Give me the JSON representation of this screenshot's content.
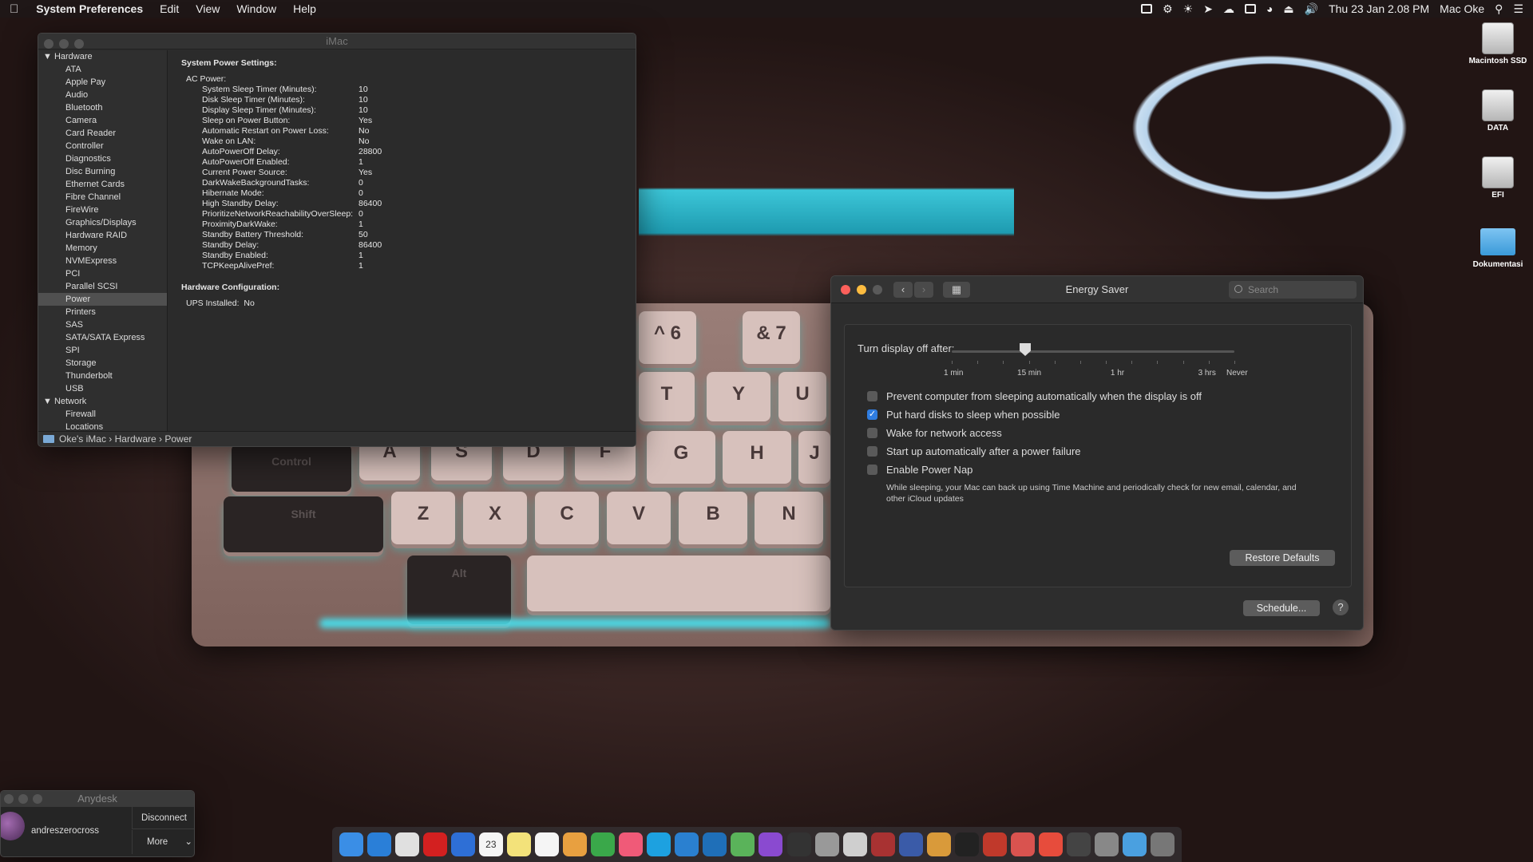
{
  "menubar": {
    "apple": "",
    "app": "System Preferences",
    "items": [
      "Edit",
      "View",
      "Window",
      "Help"
    ],
    "datetime": "Thu 23 Jan  2.08 PM",
    "user": "Mac Oke"
  },
  "sysinfo": {
    "title": "iMac",
    "sidebar": {
      "hardware": "Hardware",
      "items": [
        "ATA",
        "Apple Pay",
        "Audio",
        "Bluetooth",
        "Camera",
        "Card Reader",
        "Controller",
        "Diagnostics",
        "Disc Burning",
        "Ethernet Cards",
        "Fibre Channel",
        "FireWire",
        "Graphics/Displays",
        "Hardware RAID",
        "Memory",
        "NVMExpress",
        "PCI",
        "Parallel SCSI",
        "Power",
        "Printers",
        "SAS",
        "SATA/SATA Express",
        "SPI",
        "Storage",
        "Thunderbolt",
        "USB"
      ],
      "network": "Network",
      "net_items": [
        "Firewall",
        "Locations"
      ]
    },
    "main": {
      "heading": "System Power Settings:",
      "ac": "AC Power:",
      "rows": [
        [
          "System Sleep Timer (Minutes):",
          "10"
        ],
        [
          "Disk Sleep Timer (Minutes):",
          "10"
        ],
        [
          "Display Sleep Timer (Minutes):",
          "10"
        ],
        [
          "Sleep on Power Button:",
          "Yes"
        ],
        [
          "Automatic Restart on Power Loss:",
          "No"
        ],
        [
          "Wake on LAN:",
          "No"
        ],
        [
          "AutoPowerOff Delay:",
          "28800"
        ],
        [
          "AutoPowerOff Enabled:",
          "1"
        ],
        [
          "Current Power Source:",
          "Yes"
        ],
        [
          "DarkWakeBackgroundTasks:",
          "0"
        ],
        [
          "Hibernate Mode:",
          "0"
        ],
        [
          "High Standby Delay:",
          "86400"
        ],
        [
          "PrioritizeNetworkReachabilityOverSleep:",
          "0"
        ],
        [
          "ProximityDarkWake:",
          "1"
        ],
        [
          "Standby Battery Threshold:",
          "50"
        ],
        [
          "Standby Delay:",
          "86400"
        ],
        [
          "Standby Enabled:",
          "1"
        ],
        [
          "TCPKeepAlivePref:",
          "1"
        ]
      ],
      "hw_heading": "Hardware Configuration:",
      "ups": "UPS Installed:",
      "ups_val": "No"
    },
    "path": [
      "Oke's iMac",
      "Hardware",
      "Power"
    ]
  },
  "energy": {
    "title": "Energy Saver",
    "search_placeholder": "Search",
    "slider_label": "Turn display off after:",
    "slider_value": "15 min",
    "ticks": [
      "1 min",
      "15 min",
      "1 hr",
      "3 hrs",
      "Never"
    ],
    "options": [
      {
        "label": "Prevent computer from sleeping automatically when the display is off",
        "checked": false
      },
      {
        "label": "Put hard disks to sleep when possible",
        "checked": true
      },
      {
        "label": "Wake for network access",
        "checked": false
      },
      {
        "label": "Start up automatically after a power failure",
        "checked": false
      },
      {
        "label": "Enable Power Nap",
        "checked": false
      }
    ],
    "nap_note": "While sleeping, your Mac can back up using Time Machine and periodically check for new email, calendar, and other iCloud updates",
    "restore": "Restore Defaults",
    "schedule": "Schedule...",
    "help": "?"
  },
  "anydesk": {
    "title": "Anydesk",
    "user": "andreszerocross",
    "disconnect": "Disconnect",
    "more": "More"
  },
  "desktop": [
    {
      "label": "Macintosh SSD",
      "icon": "drive-icon"
    },
    {
      "label": "DATA",
      "icon": "drive-icon"
    },
    {
      "label": "EFI",
      "icon": "drive-icon"
    },
    {
      "label": "Dokumentasi",
      "icon": "folder-icon"
    }
  ],
  "keyboard": {
    "keys": [
      "^ 6",
      "& 7",
      "T",
      "Y",
      "U",
      "A",
      "S",
      "D",
      "F",
      "G",
      "H",
      "J",
      "Z",
      "X",
      "C",
      "V",
      "B",
      "N",
      "Control",
      "Shift",
      "Alt"
    ]
  },
  "dock": [
    "finder",
    "safari",
    "chrome",
    "opera",
    "xcode",
    "calendar",
    "notes",
    "reminders",
    "photos",
    "evernote",
    "music",
    "skype",
    "vscode",
    "trello",
    "android-studio",
    "phpstorm",
    "intellij",
    "database",
    "sequel-pro",
    "photo-booth",
    "squash",
    "cycling",
    "unity",
    "filezilla",
    "git",
    "git-tower",
    "inkscape",
    "system-preferences",
    "downloads-folder",
    "trash"
  ],
  "calendar_day": "23"
}
